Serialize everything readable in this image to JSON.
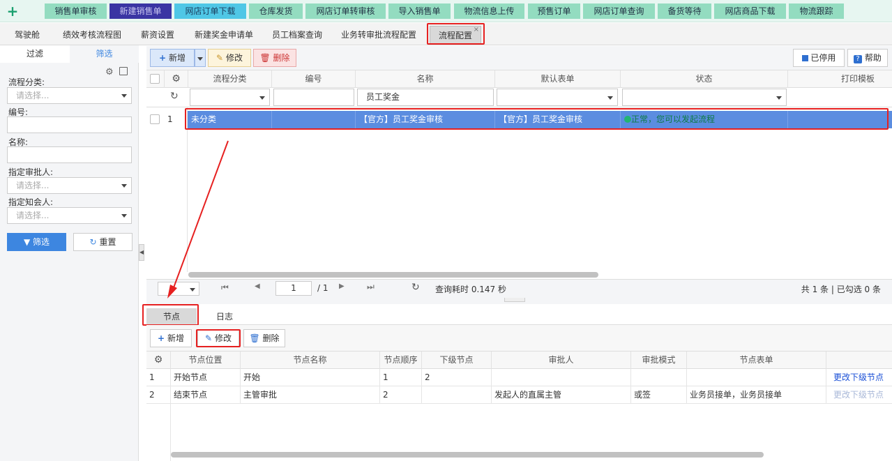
{
  "topbar": {
    "items": [
      "销售单审核",
      "新建销售单",
      "网店订单下载",
      "仓库发货",
      "网店订单转审核",
      "导入销售单",
      "物流信息上传",
      "预售订单",
      "网店订单查询",
      "备货等待",
      "网店商品下载",
      "物流跟踪"
    ],
    "plus": "+"
  },
  "tabs": {
    "items": [
      "驾驶舱",
      "绩效考核流程图",
      "薪资设置",
      "新建奖金申请单",
      "员工档案查询",
      "业务转审批流程配置",
      "流程配置"
    ],
    "close": "×"
  },
  "left": {
    "tab_filter": "过滤",
    "tab_screen": "筛选",
    "labels": {
      "category": "流程分类:",
      "number": "编号:",
      "name": "名称:",
      "approver": "指定审批人:",
      "notifier": "指定知会人:"
    },
    "placeholder": "请选择...",
    "filter_btn": "筛选",
    "reset_btn": "重置"
  },
  "toolbar": {
    "add": "新增",
    "edit": "修改",
    "delete": "删除",
    "disabled": "已停用",
    "help": "帮助"
  },
  "grid": {
    "headers": [
      "流程分类",
      "编号",
      "名称",
      "默认表单",
      "状态",
      "打印模板"
    ],
    "filter_name": "员工奖金",
    "rows": [
      {
        "index": "1",
        "category": "未分类",
        "number": "",
        "name": "【官方】员工奖金审核",
        "form": "【官方】员工奖金审核",
        "status": "正常，您可以发起流程"
      }
    ]
  },
  "pager": {
    "page": "1",
    "total_pages": "/ 1",
    "time": "查询耗时 0.147 秒",
    "summary": "共 1 条 | 已勾选 0 条"
  },
  "bottom": {
    "tabs": [
      "节点",
      "日志"
    ],
    "add": "新增",
    "edit": "修改",
    "delete": "删除",
    "headers": [
      "节点位置",
      "节点名称",
      "节点顺序",
      "下级节点",
      "审批人",
      "审批模式",
      "节点表单"
    ],
    "rows": [
      {
        "no": "1",
        "position": "开始节点",
        "name": "开始",
        "order": "1",
        "next": "2",
        "approver": "",
        "mode": "",
        "form": "",
        "action": "更改下级节点"
      },
      {
        "no": "2",
        "position": "结束节点",
        "name": "主管审批",
        "order": "2",
        "next": "",
        "approver": "发起人的直属主管",
        "mode": "或签",
        "form": "业务员接单，业务员接单",
        "action": "更改下级节点"
      }
    ]
  },
  "colors": {
    "accent": "#5b8de0",
    "annotation": "#e62020",
    "status_ok": "#22b573"
  }
}
